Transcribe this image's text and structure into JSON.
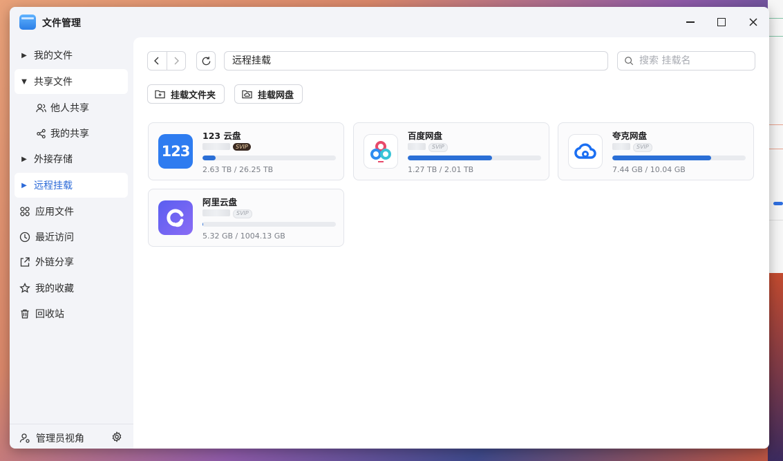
{
  "app": {
    "title": "文件管理"
  },
  "sidebar": {
    "items": [
      {
        "label": "我的文件"
      },
      {
        "label": "共享文件"
      },
      {
        "label": "他人共享"
      },
      {
        "label": "我的共享"
      },
      {
        "label": "外接存储"
      },
      {
        "label": "远程挂载"
      },
      {
        "label": "应用文件"
      },
      {
        "label": "最近访问"
      },
      {
        "label": "外链分享"
      },
      {
        "label": "我的收藏"
      },
      {
        "label": "回收站"
      }
    ],
    "admin_label": "管理员视角"
  },
  "toolbar": {
    "path": "远程挂载",
    "search_placeholder": "搜索 挂载名"
  },
  "actions": {
    "mount_folder": "挂载文件夹",
    "mount_netdisk": "挂载网盘"
  },
  "cards": [
    {
      "name": "123 云盘",
      "tag": "SVIP",
      "usage": "2.63 TB / 26.25 TB",
      "fill": 0.1
    },
    {
      "name": "百度网盘",
      "tag": "SVIP",
      "usage": "1.27 TB / 2.01 TB",
      "fill": 0.63
    },
    {
      "name": "夸克网盘",
      "tag": "SVIP",
      "usage": "7.44 GB / 10.04 GB",
      "fill": 0.74
    },
    {
      "name": "阿里云盘",
      "tag": "SVIP",
      "usage": "5.32 GB / 1004.13 GB",
      "fill": 0.005
    }
  ],
  "colors": {
    "accent": "#2c6ad8",
    "progress": "#2b6fd6"
  }
}
